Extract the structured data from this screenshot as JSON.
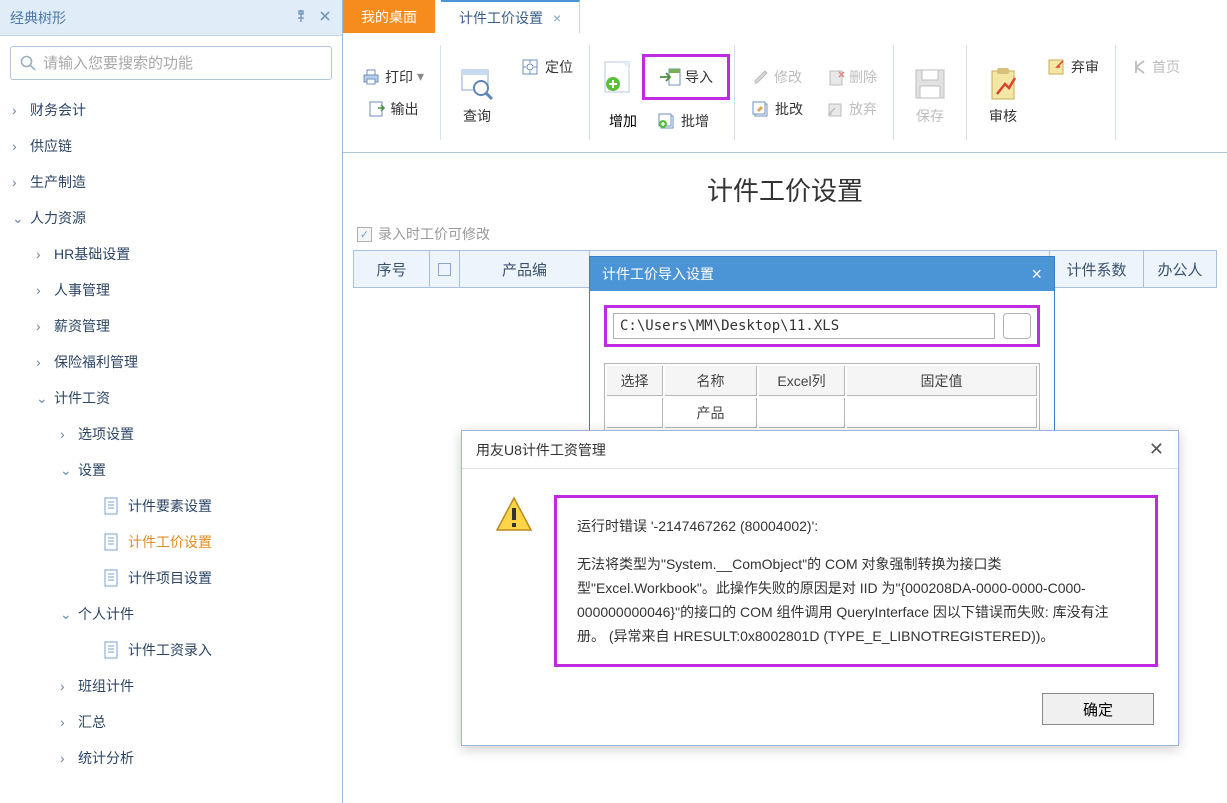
{
  "sidebar": {
    "title": "经典树形",
    "search_placeholder": "请输入您要搜索的功能",
    "items": [
      {
        "lvl": 1,
        "exp": ">",
        "label": "财务会计"
      },
      {
        "lvl": 1,
        "exp": ">",
        "label": "供应链"
      },
      {
        "lvl": 1,
        "exp": ">",
        "label": "生产制造"
      },
      {
        "lvl": 1,
        "exp": "v",
        "label": "人力资源"
      },
      {
        "lvl": 2,
        "exp": ">",
        "label": "HR基础设置"
      },
      {
        "lvl": 2,
        "exp": ">",
        "label": "人事管理"
      },
      {
        "lvl": 2,
        "exp": ">",
        "label": "薪资管理"
      },
      {
        "lvl": 2,
        "exp": ">",
        "label": "保险福利管理"
      },
      {
        "lvl": 2,
        "exp": "v",
        "label": "计件工资"
      },
      {
        "lvl": 3,
        "exp": ">",
        "label": "选项设置"
      },
      {
        "lvl": 3,
        "exp": "v",
        "label": "设置"
      },
      {
        "lvl": 4,
        "exp": "",
        "icon": "doc",
        "label": "计件要素设置"
      },
      {
        "lvl": 4,
        "exp": "",
        "icon": "doc",
        "label": "计件工价设置",
        "active": true
      },
      {
        "lvl": 4,
        "exp": "",
        "icon": "doc",
        "label": "计件项目设置"
      },
      {
        "lvl": 3,
        "exp": "v",
        "label": "个人计件"
      },
      {
        "lvl": 4,
        "exp": "",
        "icon": "doc",
        "label": "计件工资录入"
      },
      {
        "lvl": 3,
        "exp": ">",
        "label": "班组计件"
      },
      {
        "lvl": 3,
        "exp": ">",
        "label": "汇总"
      },
      {
        "lvl": 3,
        "exp": ">",
        "label": "统计分析"
      }
    ]
  },
  "tabs": {
    "home": "我的桌面",
    "active": "计件工价设置"
  },
  "ribbon": {
    "print": "打印",
    "export": "输出",
    "query": "查询",
    "locate": "定位",
    "add": "增加",
    "import": "导入",
    "batchadd": "批增",
    "modify": "修改",
    "batchmod": "批改",
    "delete": "删除",
    "abandon": "放弃",
    "save": "保存",
    "audit": "审核",
    "discard": "弃审",
    "home": "首页"
  },
  "page": {
    "title": "计件工价设置",
    "checkbox_label": "录入时工价可修改"
  },
  "table_headers": {
    "seq": "序号",
    "product": "产品编",
    "coefficient": "计件系数",
    "office": "办公人"
  },
  "import_dialog": {
    "title": "计件工价导入设置",
    "path": "C:\\Users\\MM\\Desktop\\11.XLS",
    "col_select": "选择",
    "col_name": "名称",
    "col_excel": "Excel列",
    "col_fixed": "固定值",
    "row1_name": "产品"
  },
  "error_dialog": {
    "title": "用友U8计件工资管理",
    "line1": "运行时错误 '-2147467262 (80004002)':",
    "line2": "无法将类型为\"System.__ComObject\"的 COM 对象强制转换为接口类型\"Excel.Workbook\"。此操作失败的原因是对 IID 为\"{000208DA-0000-0000-C000-000000000046}\"的接口的 COM 组件调用 QueryInterface 因以下错误而失败: 库没有注册。 (异常来自 HRESULT:0x8002801D (TYPE_E_LIBNOTREGISTERED))。",
    "ok": "确定"
  }
}
